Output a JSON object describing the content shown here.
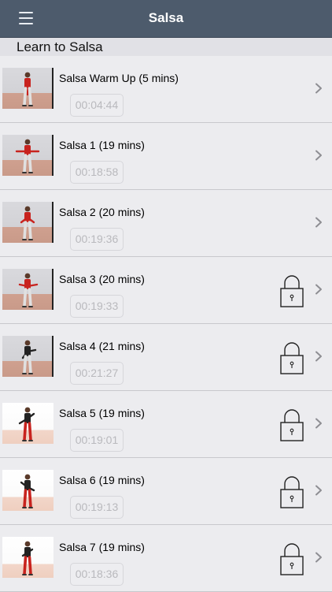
{
  "header": {
    "title": "Salsa",
    "menu_icon": "hamburger-menu-icon",
    "background": "#4d5b6c"
  },
  "section": {
    "title": "Learn to Salsa"
  },
  "lessons": [
    {
      "title": "Salsa Warm Up (5 mins)",
      "duration": "00:04:44",
      "locked": false,
      "shirt": "#c8231e",
      "pants": "#e0e0e0"
    },
    {
      "title": "Salsa 1 (19 mins)",
      "duration": "00:18:58",
      "locked": false,
      "shirt": "#c8231e",
      "pants": "#e0e0e0"
    },
    {
      "title": "Salsa 2 (20 mins)",
      "duration": "00:19:36",
      "locked": false,
      "shirt": "#c8231e",
      "pants": "#e0e0e0"
    },
    {
      "title": "Salsa 3 (20 mins)",
      "duration": "00:19:33",
      "locked": true,
      "shirt": "#c8231e",
      "pants": "#e0e0e0"
    },
    {
      "title": "Salsa 4 (21 mins)",
      "duration": "00:21:27",
      "locked": true,
      "shirt": "#222222",
      "pants": "#e0e0e0"
    },
    {
      "title": "Salsa 5 (19 mins)",
      "duration": "00:19:01",
      "locked": true,
      "shirt": "#222222",
      "pants": "#c8231e"
    },
    {
      "title": "Salsa 6 (19 mins)",
      "duration": "00:19:13",
      "locked": true,
      "shirt": "#222222",
      "pants": "#c8231e"
    },
    {
      "title": "Salsa 7 (19 mins)",
      "duration": "00:18:36",
      "locked": true,
      "shirt": "#222222",
      "pants": "#c8231e"
    }
  ]
}
